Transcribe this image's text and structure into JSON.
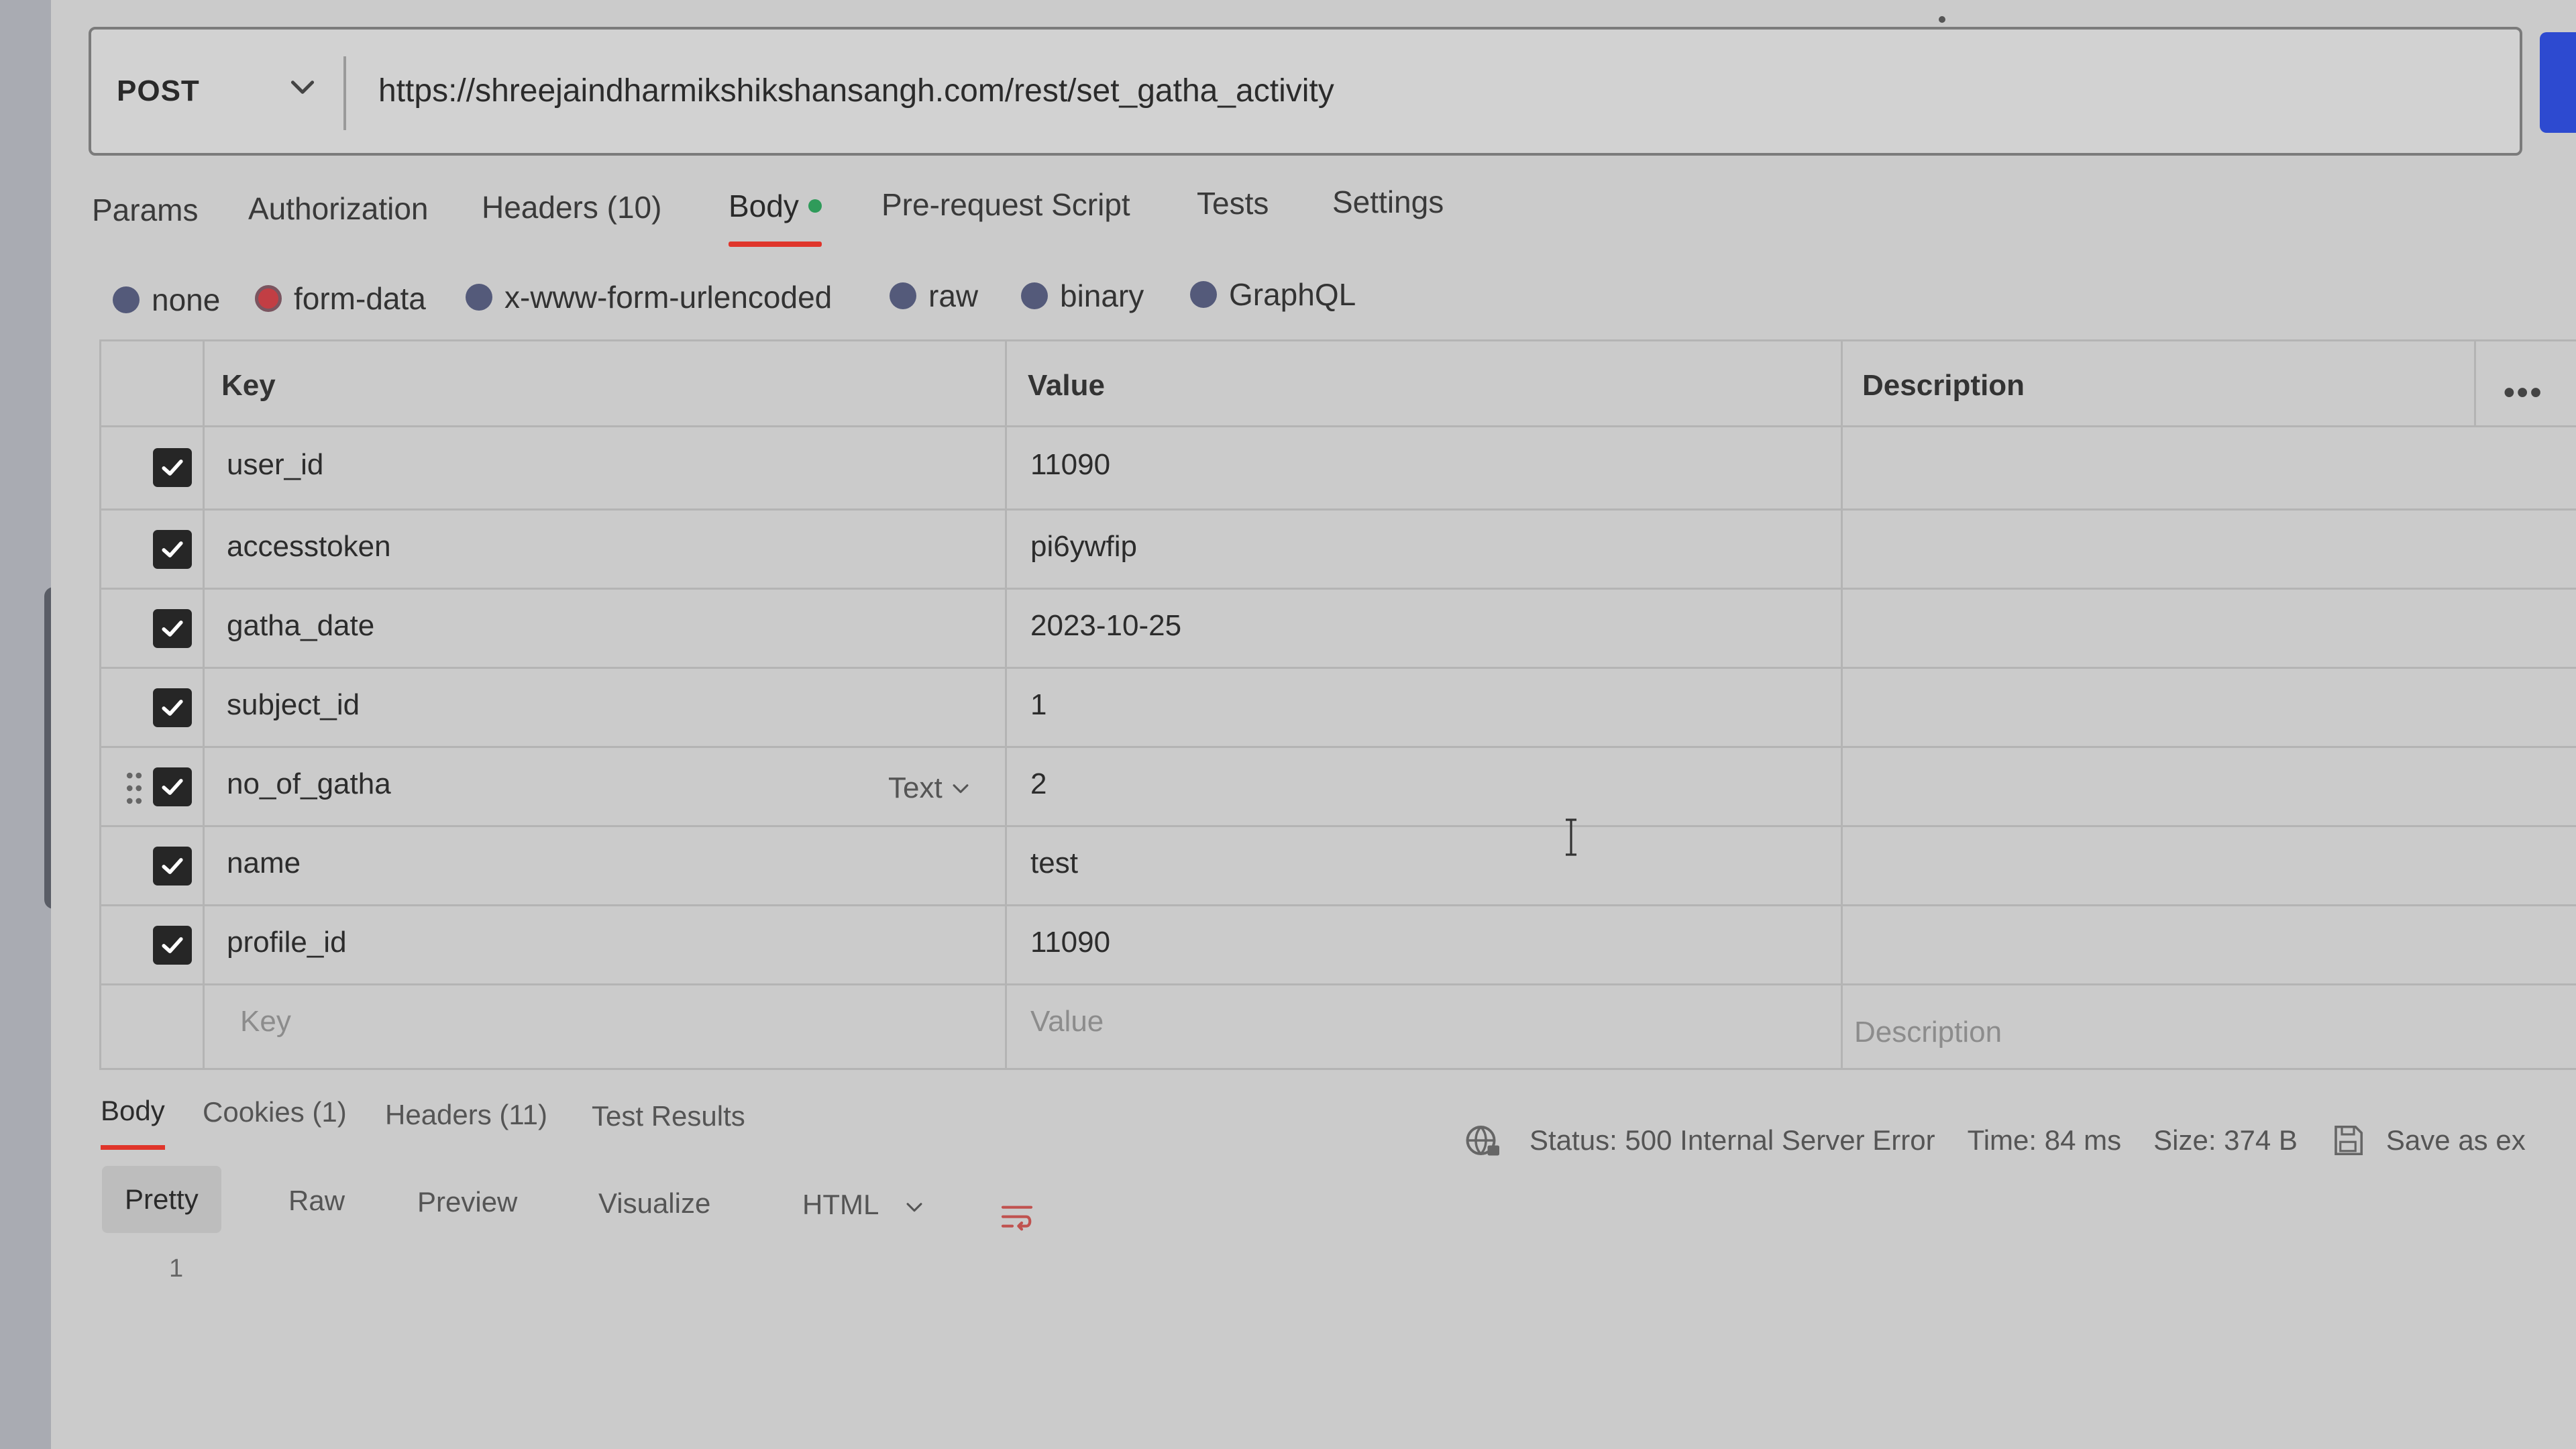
{
  "request": {
    "method": "POST",
    "url": "https://shreejaindharmikshikshansangh.com/rest/set_gatha_activity"
  },
  "tabs": [
    {
      "label": "Params"
    },
    {
      "label": "Authorization"
    },
    {
      "label": "Headers (10)"
    },
    {
      "label": "Body",
      "active": true
    },
    {
      "label": "Pre-request Script"
    },
    {
      "label": "Tests"
    },
    {
      "label": "Settings"
    }
  ],
  "body_types": [
    {
      "label": "none"
    },
    {
      "label": "form-data",
      "selected": true
    },
    {
      "label": "x-www-form-urlencoded"
    },
    {
      "label": "raw"
    },
    {
      "label": "binary"
    },
    {
      "label": "GraphQL"
    }
  ],
  "table": {
    "headers": {
      "key": "Key",
      "value": "Value",
      "description": "Description"
    },
    "rows": [
      {
        "key": "user_id",
        "value": "11090",
        "checked": true
      },
      {
        "key": "accesstoken",
        "value": "pi6ywfip",
        "checked": true
      },
      {
        "key": "gatha_date",
        "value": "2023-10-25",
        "checked": true
      },
      {
        "key": "subject_id",
        "value": "1",
        "checked": true
      },
      {
        "key": "no_of_gatha",
        "value": "2",
        "checked": true,
        "type": "Text"
      },
      {
        "key": "name",
        "value": "test",
        "checked": true
      },
      {
        "key": "profile_id",
        "value": "11090",
        "checked": true
      }
    ],
    "placeholder": {
      "key": "Key",
      "value": "Value",
      "description": "Description"
    }
  },
  "response": {
    "tabs": [
      {
        "label": "Body",
        "active": true
      },
      {
        "label": "Cookies (1)"
      },
      {
        "label": "Headers (11)"
      },
      {
        "label": "Test Results"
      }
    ],
    "status": "Status: 500 Internal Server Error",
    "time": "Time: 84 ms",
    "size": "Size: 374 B",
    "save_label": "Save as ex",
    "views": [
      {
        "label": "Pretty",
        "selected": true
      },
      {
        "label": "Raw"
      },
      {
        "label": "Preview"
      },
      {
        "label": "Visualize"
      }
    ],
    "format": "HTML",
    "line_number": "1"
  },
  "colors": {
    "accent": "#e0352b",
    "send": "#2d4ad0",
    "radio": "#545a7a",
    "radio_selected": "#c23e44"
  }
}
